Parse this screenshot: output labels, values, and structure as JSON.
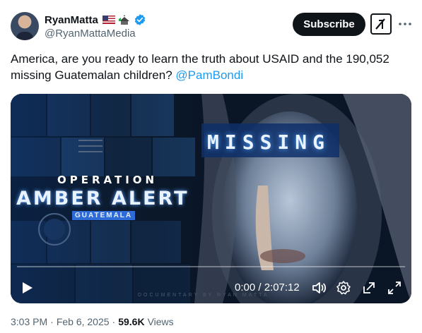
{
  "author": {
    "display_name": "RyanMatta",
    "handle": "@RyanMattaMedia",
    "badges": [
      "us-flag-icon",
      "church-icon",
      "verified-badge-icon"
    ]
  },
  "actions": {
    "subscribe_label": "Subscribe",
    "grok_icon": "grok-icon",
    "more_icon": "more-dots-icon"
  },
  "tweet": {
    "text": "America, are you ready to learn the truth about USAID and the 190,052 missing Guatemalan children? ",
    "mention": "@PamBondi"
  },
  "video": {
    "thumbnail_texts": {
      "operation": "OPERATION",
      "amber_alert": "AMBER ALERT",
      "guatemala": "GUATEMALA",
      "missing": "MISSING",
      "credit": "DOCUMENTARY BY RYAN MATTA"
    },
    "time_display": "0:00 / 2:07:12",
    "progress_fraction": 0,
    "controls": [
      "play-icon",
      "volume-icon",
      "settings-gear-icon",
      "pop-out-icon",
      "fullscreen-icon"
    ]
  },
  "meta": {
    "time": "3:03 PM",
    "separator": "·",
    "date": "Feb 6, 2025",
    "views_count": "59.6K",
    "views_label": "Views"
  },
  "colors": {
    "accent": "#1d9bf0",
    "text": "#0f1419",
    "muted": "#536471",
    "verified": "#1d9bf0"
  }
}
